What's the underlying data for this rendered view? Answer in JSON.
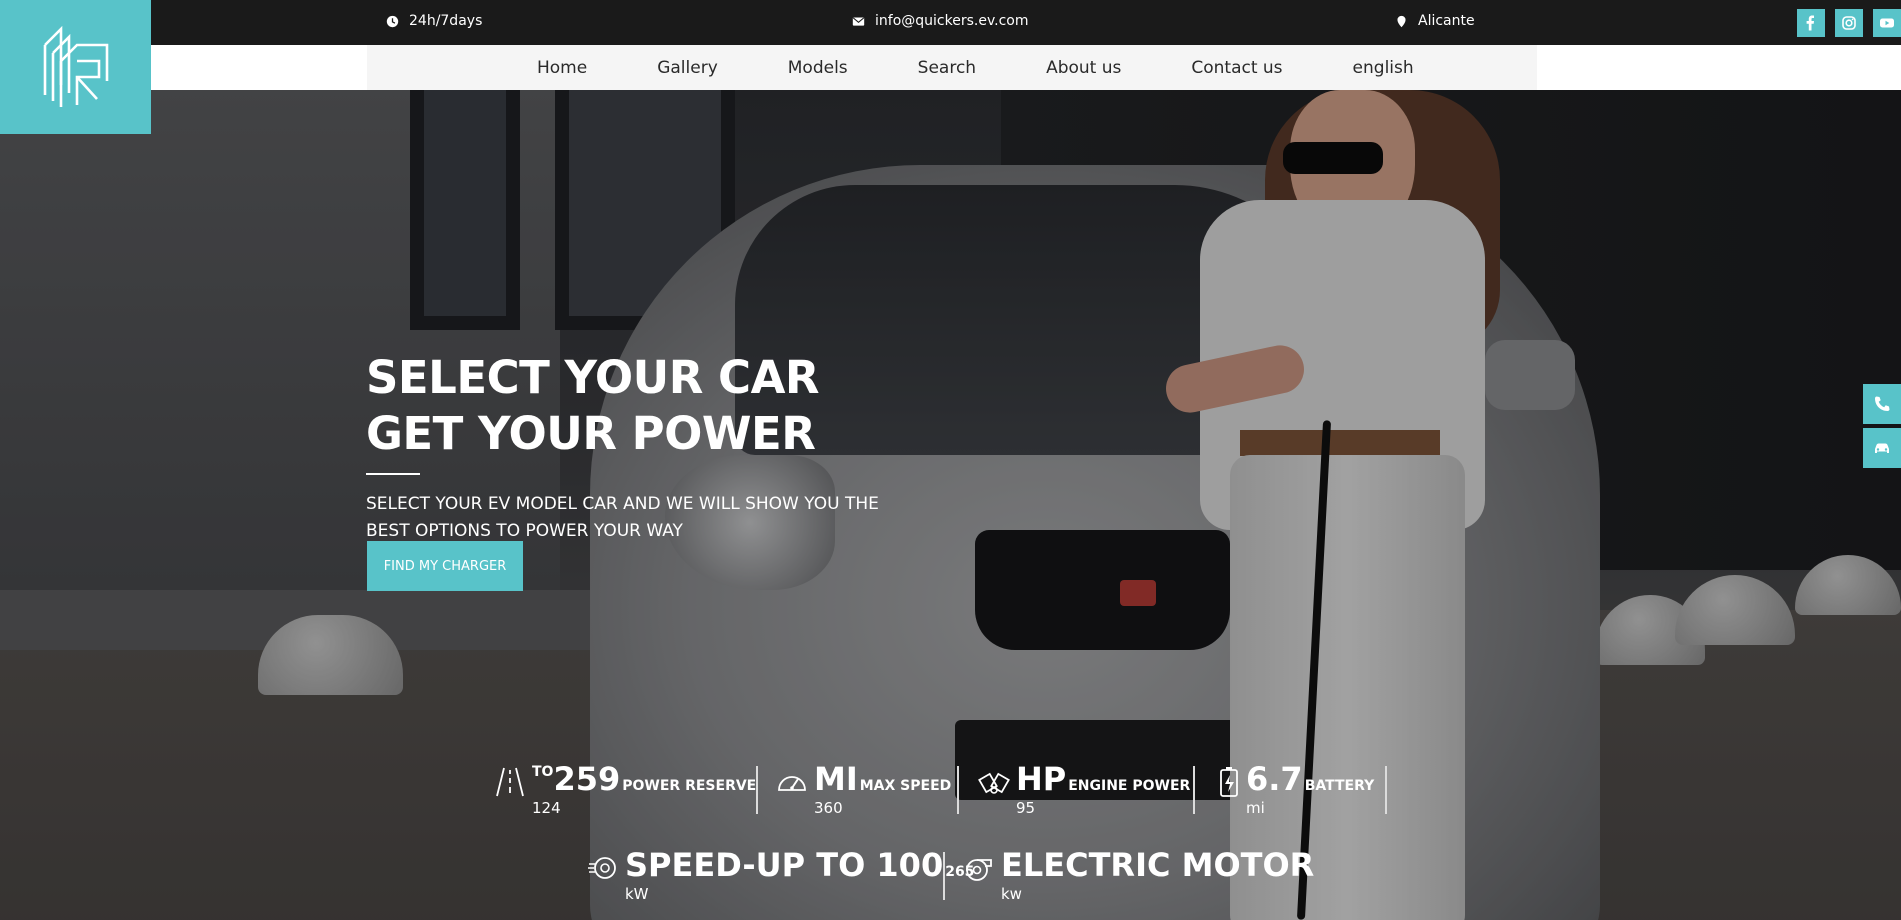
{
  "topbar": {
    "hours": "24h/7days",
    "email": "info@quickers.ev.com",
    "location": "Alicante",
    "social": [
      "facebook-icon",
      "instagram-icon",
      "youtube-icon"
    ]
  },
  "nav": {
    "items": [
      "Home",
      "Gallery",
      "Models",
      "Search",
      "About us",
      "Contact us",
      "english"
    ]
  },
  "hero": {
    "title_line1": "SELECT YOUR CAR",
    "title_line2": "GET YOUR POWER",
    "subtitle": "SELECT YOUR EV MODEL CAR AND WE WILL SHOW YOU THE BEST OPTIONS TO POWER YOUR WAY",
    "cta_label": "FIND MY CHARGER"
  },
  "specs": {
    "power_reserve": {
      "prefix": "TO",
      "value": "259",
      "label": "POWER RESERVE",
      "sub": "124"
    },
    "max_speed": {
      "value": "MI",
      "label": "MAX SPEED",
      "sub": "360"
    },
    "engine_power": {
      "value": "HP",
      "label": "ENGINE POWER",
      "sub": "95"
    },
    "battery": {
      "value": "6.7",
      "label": "BATTERY",
      "sub": "mi"
    },
    "speed_up": {
      "value": "SPEED-UP TO 100",
      "label": "265",
      "sub": "kW"
    },
    "motor": {
      "value": "ELECTRIC MOTOR",
      "label": "",
      "sub": "kw"
    }
  },
  "colors": {
    "accent": "#58c3c9",
    "topbar": "#1a1a1a",
    "nav_bg": "#f5f5f5"
  },
  "side_buttons": [
    "phone-icon",
    "car-icon"
  ]
}
